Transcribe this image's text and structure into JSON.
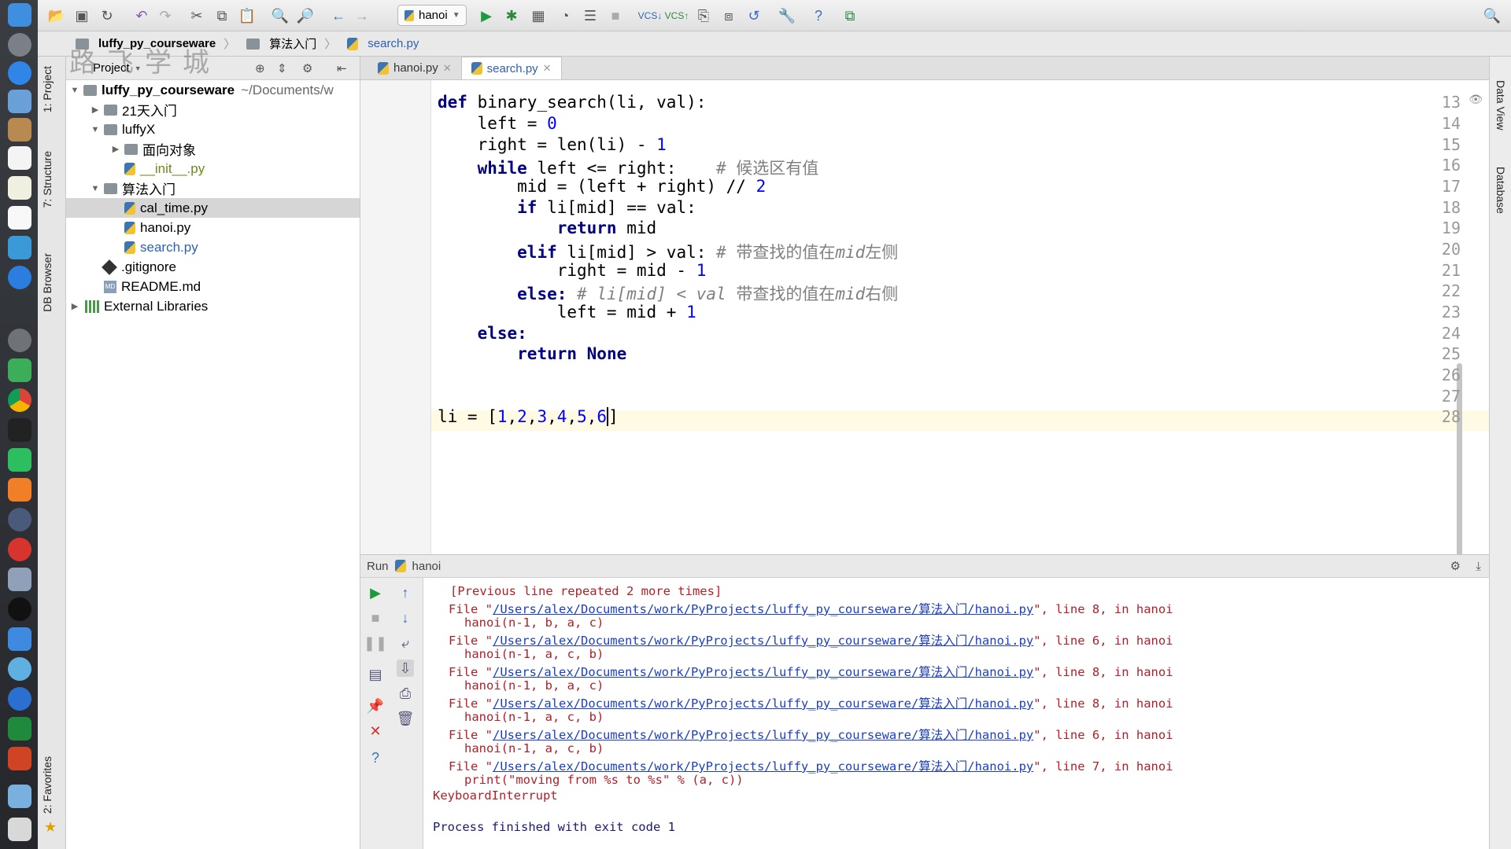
{
  "toolbar": {
    "run_config": "hanoi"
  },
  "breadcrumbs": [
    "luffy_py_courseware",
    "算法入门",
    "search.py"
  ],
  "watermark": "路飞学城",
  "project": {
    "header_label": "Project",
    "tree": [
      {
        "label": "luffy_py_courseware",
        "suffix": "~/Documents/w"
      },
      {
        "label": "21天入门"
      },
      {
        "label": "luffyX"
      },
      {
        "label": "面向对象"
      },
      {
        "label": "__init__.py"
      },
      {
        "label": "算法入门"
      },
      {
        "label": "cal_time.py"
      },
      {
        "label": "hanoi.py"
      },
      {
        "label": "search.py"
      },
      {
        "label": ".gitignore"
      },
      {
        "label": "README.md"
      },
      {
        "label": "External Libraries"
      }
    ]
  },
  "side_tabs": {
    "left": [
      "1: Project",
      "7: Structure",
      "DB Browser",
      "2: Favorites"
    ],
    "right": [
      "Data View",
      "Database"
    ]
  },
  "tabs": [
    {
      "label": "hanoi.py"
    },
    {
      "label": "search.py"
    }
  ],
  "editor": {
    "line_numbers": [
      "13",
      "14",
      "15",
      "16",
      "17",
      "18",
      "19",
      "20",
      "21",
      "22",
      "23",
      "24",
      "25",
      "26",
      "27",
      "28"
    ],
    "lines": {
      "l13": {
        "kw": "def",
        "rest": " binary_search(li, val):"
      },
      "l14": {
        "a": "    left = ",
        "n": "0"
      },
      "l15": {
        "a": "    right = len(li) - ",
        "n": "1"
      },
      "l16": {
        "ind": "    ",
        "kw": "while",
        "rest": " left <= right:    ",
        "c": "# 候选区有值"
      },
      "l17": {
        "a": "        mid = (left + right) // ",
        "n": "2"
      },
      "l18": {
        "ind": "        ",
        "kw": "if",
        "rest": " li[mid] == val:"
      },
      "l19": {
        "ind": "            ",
        "kw": "return",
        "rest": " mid"
      },
      "l20": {
        "ind": "        ",
        "kw": "elif",
        "rest": " li[mid] > val: ",
        "c1": "# 带查找的值在",
        "ci": "mid",
        "c2": "左侧"
      },
      "l21": {
        "a": "            right = mid - ",
        "n": "1"
      },
      "l22": {
        "ind": "        ",
        "kw": "else:",
        "rest": " ",
        "ci1": "# li[mid] < val ",
        "c1": "带查找的值在",
        "ci": "mid",
        "c2": "右侧"
      },
      "l23": {
        "a": "            left = mid + ",
        "n": "1"
      },
      "l24": {
        "ind": "    ",
        "kw": "else:"
      },
      "l25": {
        "ind": "        ",
        "kw": "return None"
      },
      "l27": {
        "a": "li = [",
        "n1": "1",
        "n2": "2",
        "n3": "3",
        "n4": "4",
        "n5": "5",
        "n6": "6",
        "b": "]"
      }
    }
  },
  "run": {
    "header_label": "Run",
    "config": "hanoi",
    "console": {
      "repeated": "[Previous line repeated 2 more times]",
      "file_prefix": "File \"",
      "path": "/Users/alex/Documents/work/PyProjects/luffy_py_courseware/算法入门/hanoi.py",
      "l8": "\", line 8, in hanoi",
      "l6": "\", line 6, in hanoi",
      "l7": "\", line 7, in hanoi",
      "call_bac": "hanoi(n-1, b, a, c)",
      "call_acb": "hanoi(n-1, a, c, b)",
      "print_line": "print(\"moving from %s to %s\" % (a, c))",
      "interrupt": "KeyboardInterrupt",
      "finished": "Process finished with exit code 1"
    }
  }
}
